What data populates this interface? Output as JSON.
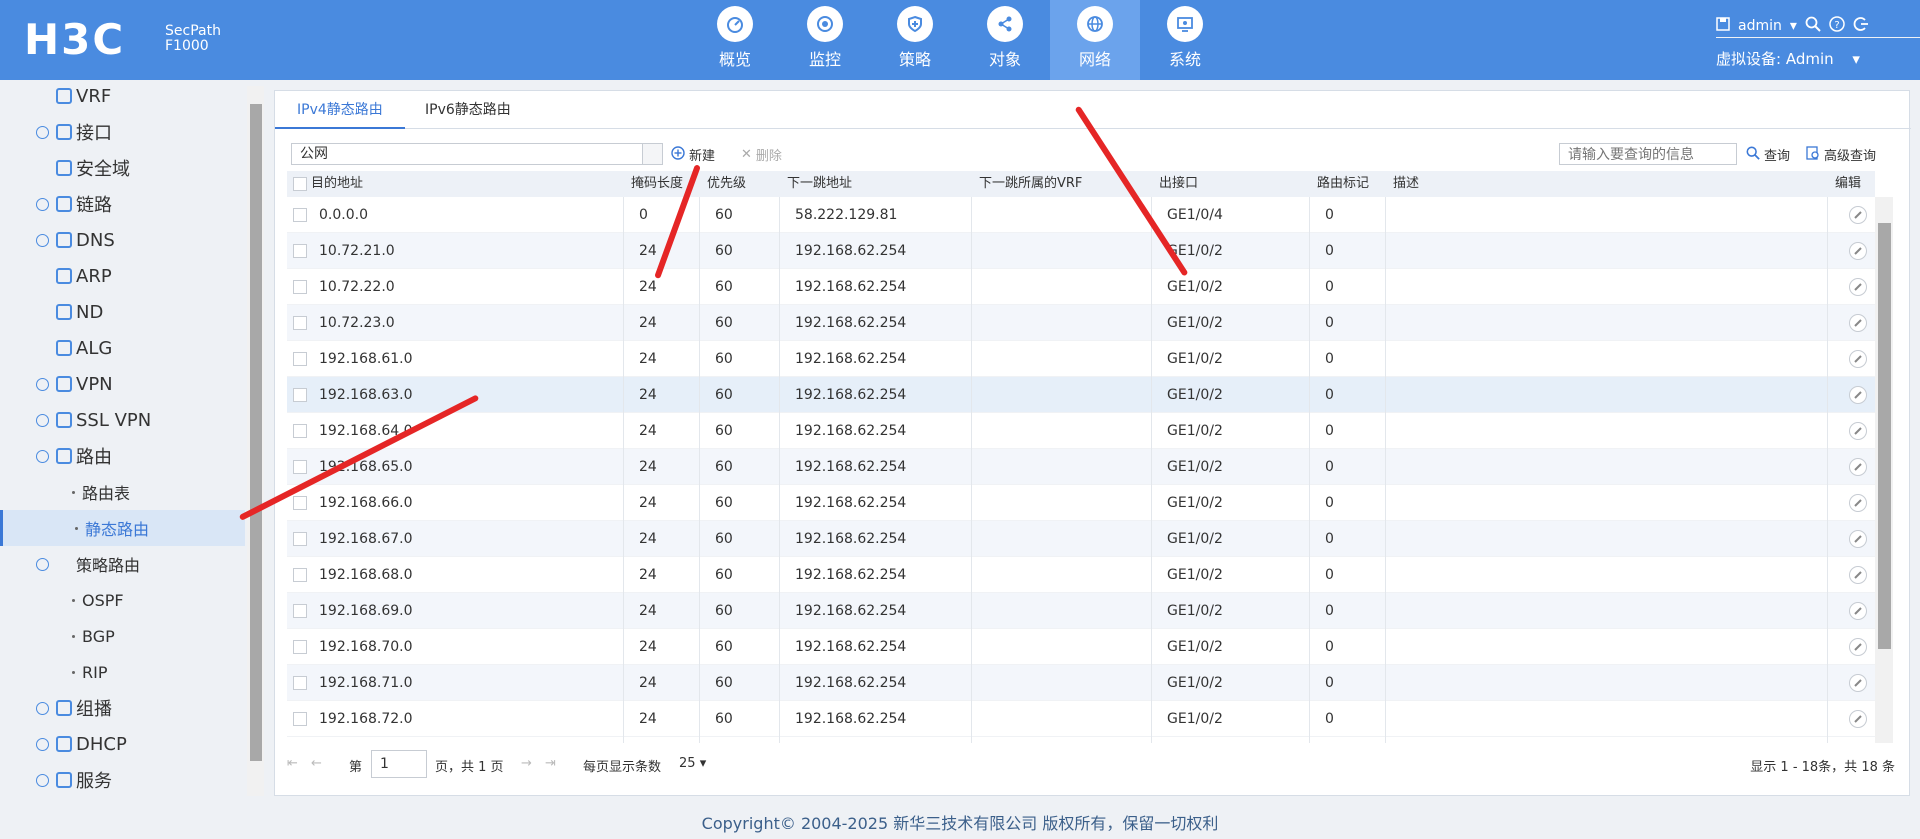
{
  "header": {
    "brand": "H3C",
    "product_line1": "SecPath",
    "product_line2": "F1000",
    "nav": [
      {
        "label": "概览",
        "icon": "gauge-icon"
      },
      {
        "label": "监控",
        "icon": "monitor-icon"
      },
      {
        "label": "策略",
        "icon": "shield-icon"
      },
      {
        "label": "对象",
        "icon": "share-icon"
      },
      {
        "label": "网络",
        "icon": "globe-icon",
        "active": true
      },
      {
        "label": "系统",
        "icon": "settings-screen-icon"
      }
    ],
    "user": "admin",
    "vdev_label": "虚拟设备: Admin"
  },
  "sidebar": {
    "items": [
      {
        "label": "VRF",
        "level": 1
      },
      {
        "label": "接口",
        "level": 0
      },
      {
        "label": "安全域",
        "level": 1
      },
      {
        "label": "链路",
        "level": 0
      },
      {
        "label": "DNS",
        "level": 0
      },
      {
        "label": "ARP",
        "level": 1
      },
      {
        "label": "ND",
        "level": 1
      },
      {
        "label": "ALG",
        "level": 1
      },
      {
        "label": "VPN",
        "level": 0
      },
      {
        "label": "SSL VPN",
        "level": 0
      },
      {
        "label": "路由",
        "level": 0
      },
      {
        "label": "路由表",
        "level": 2
      },
      {
        "label": "静态路由",
        "level": 2,
        "active": true
      },
      {
        "label": "策略路由",
        "level": 1
      },
      {
        "label": "OSPF",
        "level": 2
      },
      {
        "label": "BGP",
        "level": 2
      },
      {
        "label": "RIP",
        "level": 2
      },
      {
        "label": "组播",
        "level": 0
      },
      {
        "label": "DHCP",
        "level": 0
      },
      {
        "label": "服务",
        "level": 0
      }
    ]
  },
  "tabs": [
    "IPv4静态路由",
    "IPv6静态路由"
  ],
  "toolbar": {
    "vrf_value": "公网",
    "new_label": "新建",
    "delete_label": "删除",
    "search_placeholder": "请输入要查询的信息",
    "query_label": "查询",
    "advanced_label": "高级查询"
  },
  "table": {
    "headers": [
      "目的地址",
      "掩码长度",
      "优先级",
      "下一跳地址",
      "下一跳所属的VRF",
      "出接口",
      "路由标记",
      "描述",
      "编辑"
    ],
    "rows": [
      [
        "0.0.0.0",
        "0",
        "60",
        "58.222.129.81",
        "",
        "GE1/0/4",
        "0",
        ""
      ],
      [
        "10.72.21.0",
        "24",
        "60",
        "192.168.62.254",
        "",
        "GE1/0/2",
        "0",
        ""
      ],
      [
        "10.72.22.0",
        "24",
        "60",
        "192.168.62.254",
        "",
        "GE1/0/2",
        "0",
        ""
      ],
      [
        "10.72.23.0",
        "24",
        "60",
        "192.168.62.254",
        "",
        "GE1/0/2",
        "0",
        ""
      ],
      [
        "192.168.61.0",
        "24",
        "60",
        "192.168.62.254",
        "",
        "GE1/0/2",
        "0",
        ""
      ],
      [
        "192.168.63.0",
        "24",
        "60",
        "192.168.62.254",
        "",
        "GE1/0/2",
        "0",
        ""
      ],
      [
        "192.168.64.0",
        "24",
        "60",
        "192.168.62.254",
        "",
        "GE1/0/2",
        "0",
        ""
      ],
      [
        "192.168.65.0",
        "24",
        "60",
        "192.168.62.254",
        "",
        "GE1/0/2",
        "0",
        ""
      ],
      [
        "192.168.66.0",
        "24",
        "60",
        "192.168.62.254",
        "",
        "GE1/0/2",
        "0",
        ""
      ],
      [
        "192.168.67.0",
        "24",
        "60",
        "192.168.62.254",
        "",
        "GE1/0/2",
        "0",
        ""
      ],
      [
        "192.168.68.0",
        "24",
        "60",
        "192.168.62.254",
        "",
        "GE1/0/2",
        "0",
        ""
      ],
      [
        "192.168.69.0",
        "24",
        "60",
        "192.168.62.254",
        "",
        "GE1/0/2",
        "0",
        ""
      ],
      [
        "192.168.70.0",
        "24",
        "60",
        "192.168.62.254",
        "",
        "GE1/0/2",
        "0",
        ""
      ],
      [
        "192.168.71.0",
        "24",
        "60",
        "192.168.62.254",
        "",
        "GE1/0/2",
        "0",
        ""
      ],
      [
        "192.168.72.0",
        "24",
        "60",
        "192.168.62.254",
        "",
        "GE1/0/2",
        "0",
        ""
      ]
    ]
  },
  "pager": {
    "page_prefix": "第",
    "page_value": "1",
    "page_suffix": "页，共 1 页",
    "per_page_label": "每页显示条数",
    "per_page_value": "25",
    "summary": "显示 1 - 18条，共 18 条"
  },
  "footer": "Copyright© 2004-2025 新华三技术有限公司 版权所有，保留一切权利",
  "colors": {
    "header": "#4a8be0",
    "accent": "#3b78d6",
    "annotation": "#e52626"
  }
}
